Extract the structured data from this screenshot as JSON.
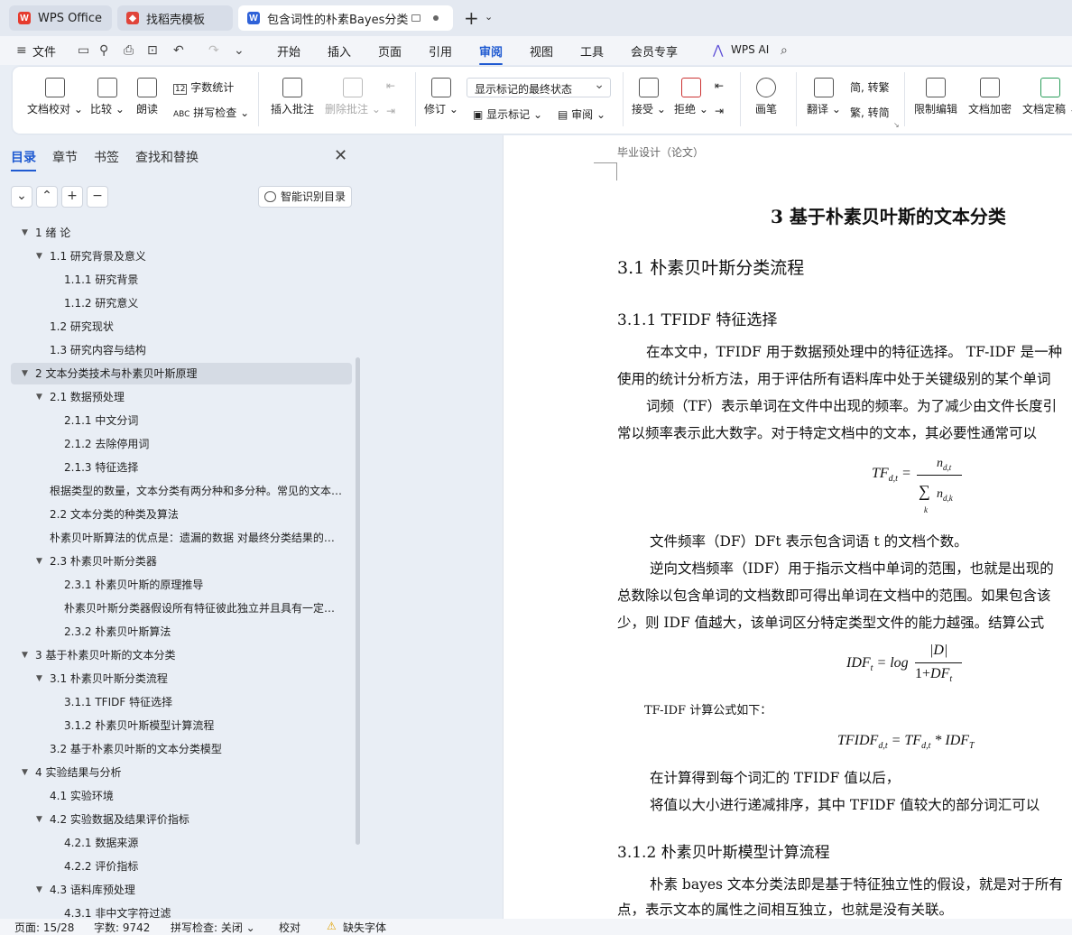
{
  "tabs": {
    "wps": "WPS Office",
    "template": "找稻壳模板",
    "doc": "包含词性的朴素Bayes分类在文本分类中的应用"
  },
  "menu": {
    "file": "文件",
    "start": "开始",
    "insert": "插入",
    "page": "页面",
    "ref": "引用",
    "review": "审阅",
    "view": "视图",
    "tools": "工具",
    "member": "会员专享",
    "ai": "WPS AI"
  },
  "ribbon": {
    "doccheck": "文档校对",
    "compare": "比较",
    "read": "朗读",
    "wordcount": "字数统计",
    "spell": "拼写检查",
    "insertcomment": "插入批注",
    "deletecomment": "删除批注",
    "revise": "修订",
    "markstate": "显示标记的最终状态",
    "showmark": "显示标记",
    "review": "审阅",
    "accept": "接受",
    "reject": "拒绝",
    "pen": "画笔",
    "translate": "翻译",
    "trad": "简, 转繁",
    "simp": "繁, 转简",
    "restrict": "限制编辑",
    "encrypt": "文档加密",
    "finalize": "文档定稿"
  },
  "nav": {
    "tab_toc": "目录",
    "tab_chapter": "章节",
    "tab_bookmark": "书签",
    "tab_find": "查找和替换",
    "smart": "智能识别目录",
    "items": [
      {
        "label": "1  绪  论",
        "level": 1,
        "arrow": "▼"
      },
      {
        "label": "1.1  研究背景及意义",
        "level": 2,
        "arrow": "▼"
      },
      {
        "label": "1.1.1  研究背景",
        "level": 3,
        "arrow": ""
      },
      {
        "label": "1.1.2  研究意义",
        "level": 3,
        "arrow": ""
      },
      {
        "label": "1.2  研究现状",
        "level": 2,
        "arrow": ""
      },
      {
        "label": "1.3  研究内容与结构",
        "level": 2,
        "arrow": ""
      },
      {
        "label": "2 文本分类技术与朴素贝叶斯原理",
        "level": 1,
        "arrow": "▼",
        "selected": true
      },
      {
        "label": "2.1  数据预处理",
        "level": 2,
        "arrow": "▼"
      },
      {
        "label": "2.1.1  中文分词",
        "level": 3,
        "arrow": ""
      },
      {
        "label": "2.1.2  去除停用词",
        "level": 3,
        "arrow": ""
      },
      {
        "label": "2.1.3  特征选择",
        "level": 3,
        "arrow": ""
      },
      {
        "label": "根据类型的数量，文本分类有两分种和多分种。常见的文本分类算法有：",
        "level": 2,
        "arrow": ""
      },
      {
        "label": "2.2    文本分类的种类及算法",
        "level": 2,
        "arrow": ""
      },
      {
        "label": "朴素贝叶斯算法的优点是：遗漏的数据    对最终分类结果的影响不大",
        "level": 2,
        "arrow": ""
      },
      {
        "label": "2.3  朴素贝叶斯分类器",
        "level": 2,
        "arrow": "▼"
      },
      {
        "label": "2.3.1    朴素贝叶斯的原理推导",
        "level": 3,
        "arrow": ""
      },
      {
        "label": "朴素贝叶斯分类器假设所有特征彼此独立并且具有一定的权重",
        "level": 3,
        "arrow": ""
      },
      {
        "label": "2.3.2    朴素贝叶斯算法",
        "level": 3,
        "arrow": ""
      },
      {
        "label": "3  基于朴素贝叶斯的文本分类",
        "level": 1,
        "arrow": "▼"
      },
      {
        "label": "3.1  朴素贝叶斯分类流程",
        "level": 2,
        "arrow": "▼"
      },
      {
        "label": "3.1.1 TFIDF 特征选择",
        "level": 3,
        "arrow": ""
      },
      {
        "label": "3.1.2  朴素贝叶斯模型计算流程",
        "level": 3,
        "arrow": ""
      },
      {
        "label": "3.2 基于朴素贝叶斯的文本分类模型",
        "level": 2,
        "arrow": ""
      },
      {
        "label": "4  实验结果与分析",
        "level": 1,
        "arrow": "▼"
      },
      {
        "label": "4.1 实验环境",
        "level": 2,
        "arrow": ""
      },
      {
        "label": "4.2 实验数据及结果评价指标",
        "level": 2,
        "arrow": "▼"
      },
      {
        "label": "4.2.1  数据来源",
        "level": 3,
        "arrow": ""
      },
      {
        "label": "4.2.2  评价指标",
        "level": 3,
        "arrow": ""
      },
      {
        "label": "4.3 语料库预处理",
        "level": 2,
        "arrow": "▼"
      },
      {
        "label": "4.3.1  非中文字符过滤",
        "level": 3,
        "arrow": ""
      }
    ]
  },
  "doc": {
    "header": "毕业设计（论文）",
    "chapter": "3  基于朴素贝叶斯的文本分类",
    "sec31": "3.1  朴素贝叶斯分类流程",
    "sec311": "3.1.1 TFIDF 特征选择",
    "p1a": "在本文中，TFIDF 用于数据预处理中的特征选择。 TF-IDF 是一种",
    "p1b": "使用的统计分析方法，用于评估所有语料库中处于关键级别的某个单词",
    "p2a": "词频（TF）表示单词在文件中出现的频率。为了减少由文件长度引",
    "p2b": "常以频率表示此大数字。对于特定文档中的文本，其必要性通常可以",
    "df": "文件频率（DF）DFt 表示包含词语 t 的文档个数。",
    "p3a": "逆向文档频率（IDF）用于指示文档中单词的范围，也就是出现的",
    "p3b": "总数除以包含单词的文档数即可得出单词在文档中的范围。如果包含该",
    "p3c": "少，则 IDF 值越大，该单词区分特定类型文件的能力越强。结算公式",
    "tfidflabel": "TF-IDF  计算公式如下：",
    "p4": "在计算得到每个词汇的 TFIDF 值以后，",
    "p5": "将值以大小进行递减排序，其中 TFIDF 值较大的部分词汇可以",
    "sec312": "3.1.2  朴素贝叶斯模型计算流程",
    "p6a": "朴素 bayes 文本分类法即是基于特征独立性的假设，就是对于所有",
    "p6b": "点，表示文本的属性之间相互独立，也就是没有关联。"
  },
  "status": {
    "page": "页面: 15/28",
    "words": "字数: 9742",
    "spell": "拼写检查: 关闭",
    "proof": "校对",
    "font": "缺失字体"
  },
  "colors": {
    "accent": "#1f5ad1",
    "wps_red": "#e63b2e"
  }
}
